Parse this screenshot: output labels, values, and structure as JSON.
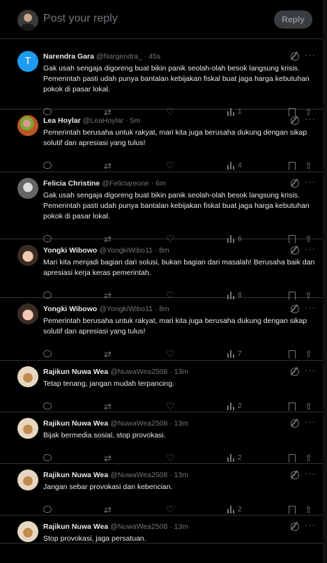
{
  "reply_box": {
    "placeholder": "Post your reply",
    "button": "Reply"
  },
  "posts": [
    {
      "name": "Narendra Gara",
      "meta": "@Nargendra_ · 45s",
      "avatar": "T",
      "avatar_class": "av-T",
      "views": "1",
      "text": "Gak usah sengaja digoreng buat bikin panik seolah-olah besok langsung krisis. Pemerintah pasti udah punya bantalan kebijakan fiskal buat jaga harga kebutuhan pokok di pasar lokal."
    },
    {
      "name": "Lea Hoylar",
      "meta": "@LeaHoylar · 5m",
      "avatar": "",
      "avatar_class": "av-lea",
      "views": "4",
      "text": "Pemerintah berusaha untuk rakyat, mari kita juga berusaha dukung dengan sikap solutif dan apresiasi yang tulus!"
    },
    {
      "name": "Felicia Christine",
      "meta": "@Feliciareone · 6m",
      "avatar": "",
      "avatar_class": "av-fel",
      "views": "6",
      "text": "Gak usah sengaja digoreng buat bikin panik seolah-olah besok langsung krisis. Pemerintah pasti udah punya bantalan kebijakan fiskal buat jaga harga kebutuhan pokok di pasar lokal."
    },
    {
      "name": "Yongki Wibowo",
      "meta": "@YongkiWibo11 · 8m",
      "avatar": "",
      "avatar_class": "av-yon",
      "views": "8",
      "text": "Mari kita menjadi bagian dari solusi, bukan bagian dari masalah! Berusaha baik dan apresiasi kerja keras pemerintah."
    },
    {
      "name": "Yongki Wibowo",
      "meta": "@YongkiWibo11 · 8m",
      "avatar": "",
      "avatar_class": "av-yon",
      "views": "7",
      "text": "Pemerintah berusaha untuk rakyat, mari kita juga berusaha dukung dengan sikap solutif dan apresiasi yang tulus!"
    },
    {
      "name": "Rajikun Nuwa Wea",
      "meta": "@NuwaWea2508 · 13m",
      "avatar": "",
      "avatar_class": "av-raj",
      "views": "2",
      "text": "Tetap tenang, jangan mudah terpancing."
    },
    {
      "name": "Rajikun Nuwa Wea",
      "meta": "@NuwaWea2508 · 13m",
      "avatar": "",
      "avatar_class": "av-raj",
      "views": "2",
      "text": "Bijak bermedia sosial, stop provokasi."
    },
    {
      "name": "Rajikun Nuwa Wea",
      "meta": "@NuwaWea2508 · 13m",
      "avatar": "",
      "avatar_class": "av-raj",
      "views": "2",
      "text": "Jangan sebar provokasi dan kebencian."
    },
    {
      "name": "Rajikun Nuwa Wea",
      "meta": "@NuwaWea2508 · 13m",
      "avatar": "",
      "avatar_class": "av-raj",
      "views": "",
      "text": "Stop provokasi, jaga persatuan."
    }
  ],
  "icons": {
    "reply": "reply-icon",
    "repost": "repost-icon",
    "like": "like-icon",
    "views": "views-icon",
    "bookmark": "bookmark-icon",
    "share": "share-icon",
    "grok": "grok-icon",
    "more": "more-icon"
  }
}
